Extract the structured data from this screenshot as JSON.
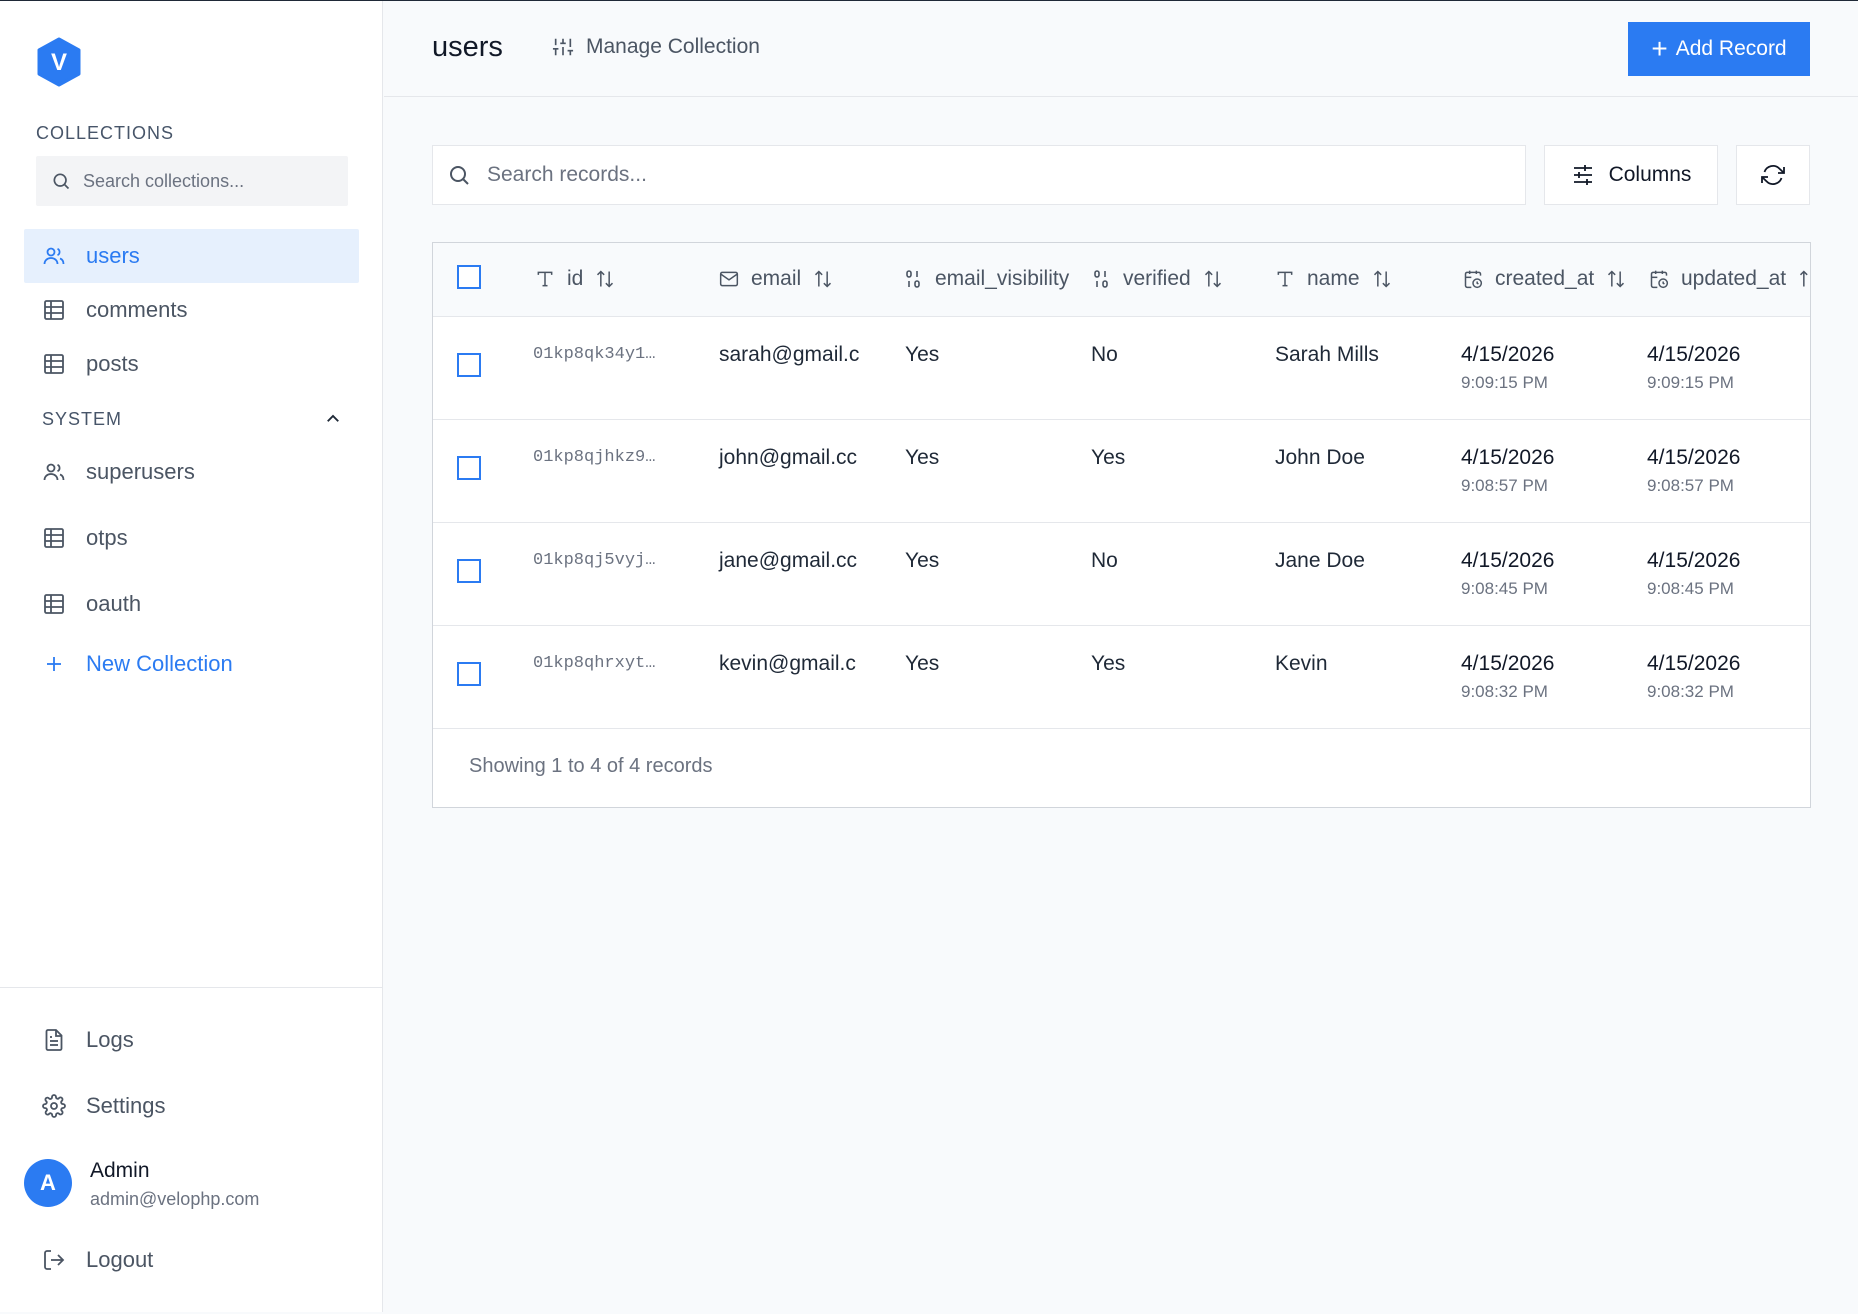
{
  "sidebar": {
    "logo_letter": "V",
    "collections_label": "COLLECTIONS",
    "search_placeholder": "Search collections...",
    "collections": [
      {
        "label": "users",
        "icon": "users-icon"
      },
      {
        "label": "comments",
        "icon": "table-icon"
      },
      {
        "label": "posts",
        "icon": "table-icon"
      }
    ],
    "system_label": "SYSTEM",
    "system_items": [
      {
        "label": "superusers",
        "icon": "users-icon"
      },
      {
        "label": "otps",
        "icon": "table-icon"
      },
      {
        "label": "oauth",
        "icon": "table-icon"
      }
    ],
    "new_collection_label": "New Collection",
    "logs_label": "Logs",
    "settings_label": "Settings",
    "user": {
      "initial": "A",
      "name": "Admin",
      "email": "admin@velophp.com"
    },
    "logout_label": "Logout"
  },
  "header": {
    "title": "users",
    "manage_label": "Manage Collection",
    "add_record_label": "Add Record"
  },
  "toolbar": {
    "search_placeholder": "Search records...",
    "columns_label": "Columns"
  },
  "table": {
    "columns": [
      "id",
      "email",
      "email_visibility",
      "verified",
      "name",
      "created_at",
      "updated_at"
    ],
    "rows": [
      {
        "id": "01kp8qk34y1…",
        "email": "sarah@gmail.c",
        "email_visibility": "Yes",
        "verified": "No",
        "name": "Sarah Mills",
        "created_date": "4/15/2026",
        "created_time": "9:09:15 PM",
        "updated_date": "4/15/2026",
        "updated_time": "9:09:15 PM"
      },
      {
        "id": "01kp8qjhkz9…",
        "email": "john@gmail.cc",
        "email_visibility": "Yes",
        "verified": "Yes",
        "name": "John Doe",
        "created_date": "4/15/2026",
        "created_time": "9:08:57 PM",
        "updated_date": "4/15/2026",
        "updated_time": "9:08:57 PM"
      },
      {
        "id": "01kp8qj5vyj…",
        "email": "jane@gmail.cc",
        "email_visibility": "Yes",
        "verified": "No",
        "name": "Jane Doe",
        "created_date": "4/15/2026",
        "created_time": "9:08:45 PM",
        "updated_date": "4/15/2026",
        "updated_time": "9:08:45 PM"
      },
      {
        "id": "01kp8qhrxyt…",
        "email": "kevin@gmail.c",
        "email_visibility": "Yes",
        "verified": "Yes",
        "name": "Kevin",
        "created_date": "4/15/2026",
        "created_time": "9:08:32 PM",
        "updated_date": "4/15/2026",
        "updated_time": "9:08:32 PM"
      }
    ],
    "footer": "Showing 1 to 4 of 4 records"
  },
  "colors": {
    "accent": "#2b7bf2",
    "active_bg": "#e6f0fd"
  }
}
